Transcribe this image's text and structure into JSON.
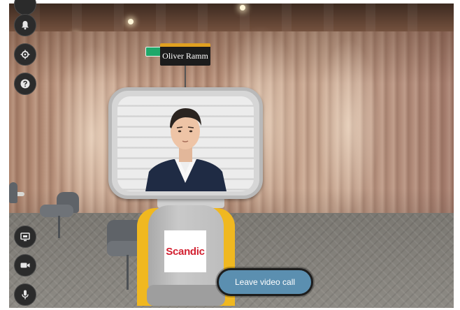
{
  "scene": {
    "name_tag": "Oliver Ramm",
    "robot_logo_text": "Scandic",
    "logo_color": "#d22030",
    "exit_sign_color": "#1fa86a"
  },
  "toolbar": {
    "buttons": [
      {
        "name": "bell-icon"
      },
      {
        "name": "settings-icon"
      },
      {
        "name": "help-icon"
      },
      {
        "name": "share-screen-icon"
      },
      {
        "name": "camera-icon"
      },
      {
        "name": "microphone-icon"
      }
    ]
  },
  "call": {
    "leave_label": "Leave video call",
    "button_color": "#5b8fb0"
  }
}
